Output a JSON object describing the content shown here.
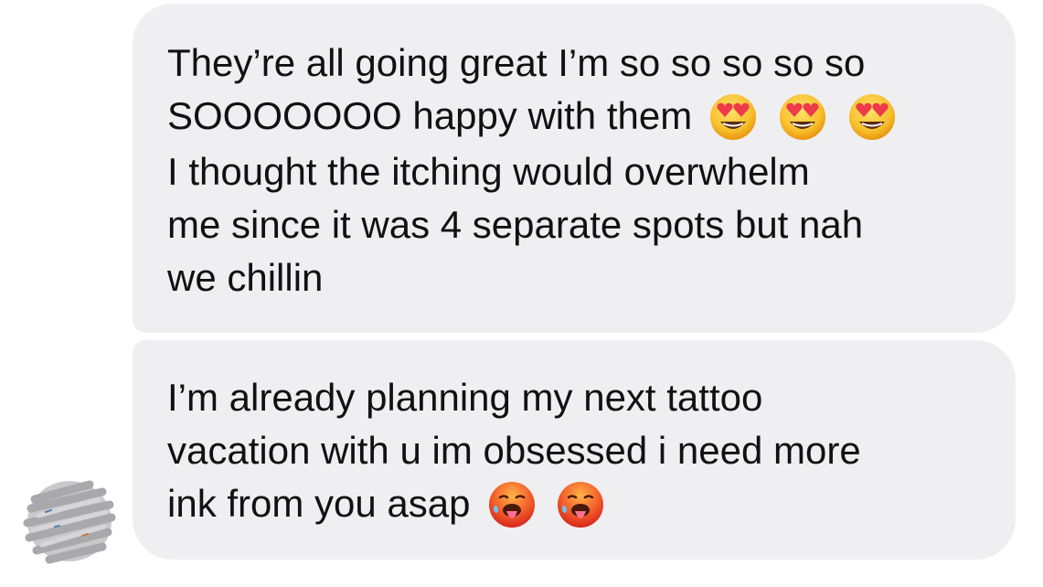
{
  "conversation": {
    "messages": [
      {
        "lines": [
          "They’re all going great I’m so so so so so",
          "SOOOOOOO happy with them",
          "I thought the itching would overwhelm",
          "me since it was 4 separate spots but nah",
          "we chillin"
        ],
        "emoji": [
          "heart-eyes-emoji",
          "heart-eyes-emoji",
          "heart-eyes-emoji"
        ]
      },
      {
        "lines": [
          "I’m already planning my next tattoo",
          "vacation with u im obsessed i need more",
          "ink from you asap"
        ],
        "emoji": [
          "hot-face-emoji",
          "hot-face-emoji"
        ]
      }
    ],
    "avatar": "redacted-avatar-scribble"
  },
  "colors": {
    "bubble_background": "#efeff2",
    "text": "#111111",
    "page_background": "#ffffff"
  }
}
